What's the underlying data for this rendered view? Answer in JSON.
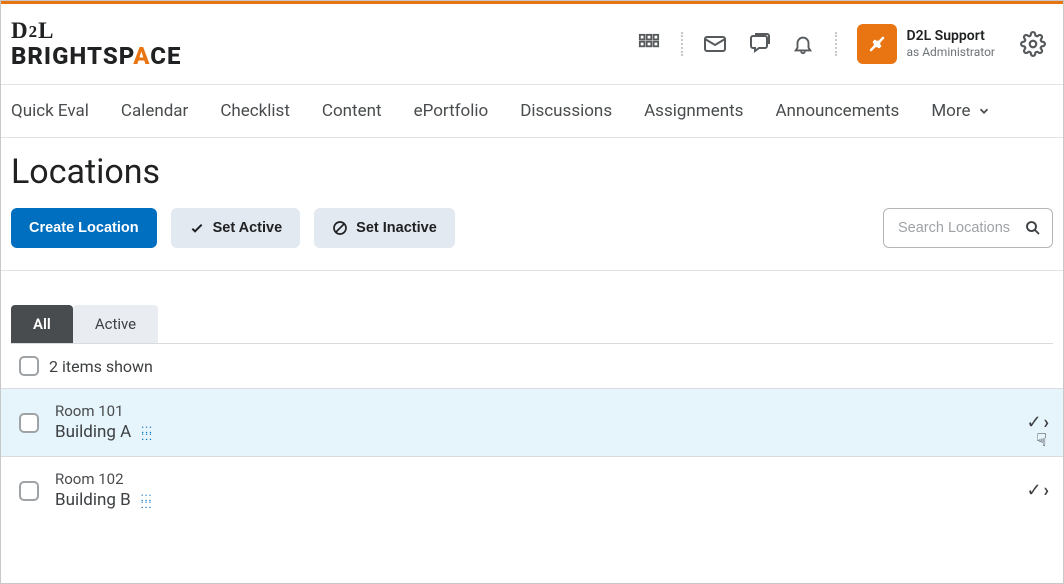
{
  "header": {
    "apps_icon": "apps-grid",
    "mail_icon": "mail",
    "chat_icon": "chat",
    "bell_icon": "bell",
    "user_name": "D2L Support",
    "user_role": "as Administrator",
    "gear_icon": "gear"
  },
  "nav": {
    "items": [
      "Quick Eval",
      "Calendar",
      "Checklist",
      "Content",
      "ePortfolio",
      "Discussions",
      "Assignments",
      "Announcements"
    ],
    "more_label": "More"
  },
  "page": {
    "title": "Locations"
  },
  "actions": {
    "create": "Create Location",
    "set_active": "Set Active",
    "set_inactive": "Set Inactive",
    "search_placeholder": "Search Locations"
  },
  "tabs": {
    "all": "All",
    "active": "Active"
  },
  "list": {
    "summary": "2 items shown",
    "items": [
      {
        "name": "Room 101",
        "building": "Building A"
      },
      {
        "name": "Room 102",
        "building": "Building B"
      }
    ]
  }
}
